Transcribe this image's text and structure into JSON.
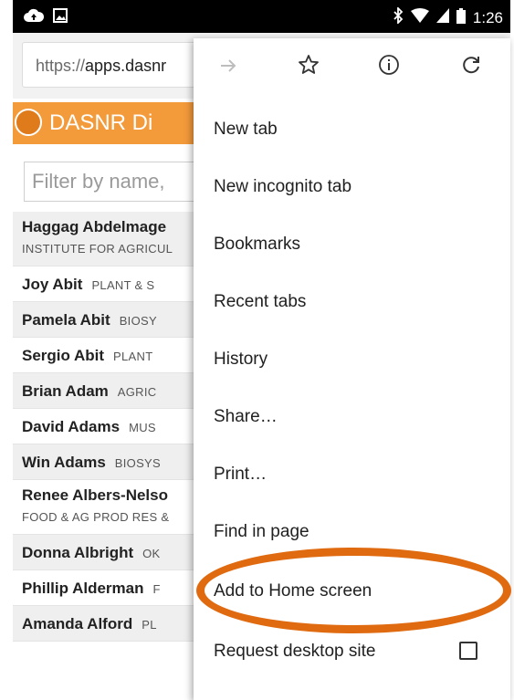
{
  "status_bar": {
    "time": "1:26",
    "left_icons": [
      "cloud-upload-icon",
      "image-icon"
    ],
    "right_icons": [
      "bluetooth-icon",
      "wifi-icon",
      "signal-icon",
      "battery-icon"
    ]
  },
  "browser": {
    "url_prefix": "https://",
    "url_host": "apps.dasnr"
  },
  "site": {
    "title": "DASNR Di",
    "filter_placeholder": "Filter by name,"
  },
  "directory": [
    {
      "name": "Haggag Abdelmage",
      "dept": "INSTITUTE FOR AGRICUL",
      "layout": "double"
    },
    {
      "name": "Joy Abit",
      "dept": "PLANT & S",
      "layout": "single"
    },
    {
      "name": "Pamela Abit",
      "dept": "BIOSY",
      "layout": "single"
    },
    {
      "name": "Sergio Abit",
      "dept": "PLANT",
      "layout": "single"
    },
    {
      "name": "Brian Adam",
      "dept": "AGRIC",
      "layout": "single"
    },
    {
      "name": "David Adams",
      "dept": "MUS",
      "layout": "single"
    },
    {
      "name": "Win Adams",
      "dept": "BIOSYS",
      "layout": "single"
    },
    {
      "name": "Renee Albers-Nelso",
      "dept": "FOOD & AG PROD RES &",
      "layout": "double"
    },
    {
      "name": "Donna Albright",
      "dept": "OK",
      "layout": "single"
    },
    {
      "name": "Phillip Alderman",
      "dept": "F",
      "layout": "single"
    },
    {
      "name": "Amanda Alford",
      "dept": "PL",
      "layout": "single"
    }
  ],
  "menu": {
    "toolbar": [
      {
        "icon": "forward-arrow-icon",
        "enabled": false
      },
      {
        "icon": "star-icon",
        "enabled": true
      },
      {
        "icon": "info-icon",
        "enabled": true
      },
      {
        "icon": "refresh-icon",
        "enabled": true
      }
    ],
    "items": [
      {
        "label": "New tab"
      },
      {
        "label": "New incognito tab"
      },
      {
        "label": "Bookmarks"
      },
      {
        "label": "Recent tabs"
      },
      {
        "label": "History"
      },
      {
        "label": "Share…"
      },
      {
        "label": "Print…"
      },
      {
        "label": "Find in page"
      },
      {
        "label": "Add to Home screen",
        "highlighted": true
      },
      {
        "label": "Request desktop site",
        "checkbox": true,
        "checked": false
      }
    ]
  },
  "colors": {
    "site_header": "#f39a3b",
    "highlight_ring": "#e06a10",
    "status_bar": "#000000"
  }
}
